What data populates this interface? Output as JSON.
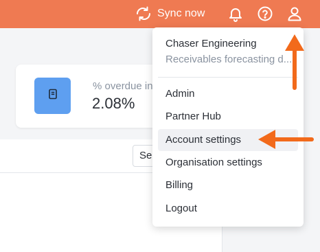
{
  "topbar": {
    "color": "#ef7a52",
    "sync_label": "Sync now",
    "icons": [
      "sync-icon",
      "bell-icon",
      "help-icon",
      "user-icon"
    ]
  },
  "stat_card": {
    "label": "% overdue in",
    "value": "2.08%",
    "icon": "document-icon",
    "icon_bg": "#5e9ff0"
  },
  "table_panel": {
    "button_label": "See"
  },
  "user_menu": {
    "org_name": "Chaser Engineering",
    "org_subtitle": "Receivables forecasting d...",
    "items": [
      {
        "label": "Admin"
      },
      {
        "label": "Partner Hub"
      },
      {
        "label": "Account settings",
        "highlighted": true
      },
      {
        "label": "Organisation settings"
      },
      {
        "label": "Billing"
      },
      {
        "label": "Logout"
      }
    ]
  },
  "annotations": {
    "arrow_color": "#f26a1b"
  }
}
